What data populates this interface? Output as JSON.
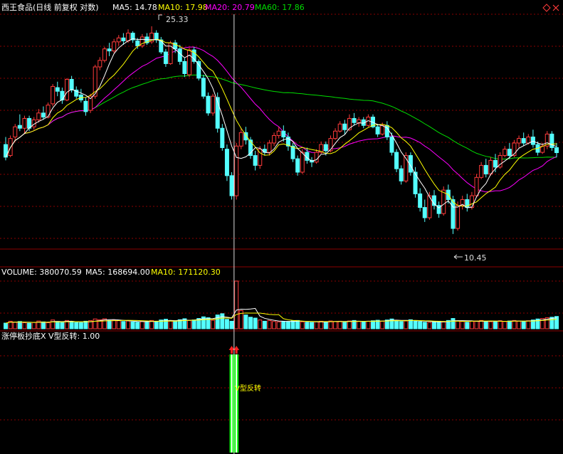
{
  "header": {
    "title": "西王食品(日线 前复权 对数)",
    "ma5_label": "MA5: 14.78",
    "ma10_label": "MA10: 17.98",
    "ma20_label": "MA20: 20.79",
    "ma60_label": "MA60: 17.86"
  },
  "volume_header": {
    "volume_label": "VOLUME: 380070.59",
    "ma5_label": "MA5: 168694.00",
    "ma10_label": "MA10: 171120.30"
  },
  "indicator_header": {
    "label": "涨停板抄底X V型反转: 1.00",
    "signal_text": "V型反转"
  },
  "annotations": {
    "high_label": "25.33",
    "low_label": "10.45"
  },
  "colors": {
    "up": "#ff3b3b",
    "down": "#54ffff",
    "ma5": "#ffffff",
    "ma10": "#ffff00",
    "ma20": "#ff00ff",
    "ma60": "#00dd00",
    "grid": "#8b0000",
    "signal_bar": "#00ff00",
    "signal_arrow": "#ff2020"
  },
  "chart_data": {
    "type": "candlestick",
    "price_scale": "log",
    "ylim": [
      9.8,
      26.5
    ],
    "highest": 25.33,
    "lowest": 10.45,
    "cursor_index": 48,
    "series": [
      {
        "name": "MA5",
        "last": 14.78
      },
      {
        "name": "MA10",
        "last": 17.98
      },
      {
        "name": "MA20",
        "last": 20.79
      },
      {
        "name": "MA60",
        "last": 17.86
      }
    ],
    "ohlc": [
      [
        15.3,
        15.8,
        14.3,
        14.5
      ],
      [
        14.6,
        15.9,
        14.5,
        15.7
      ],
      [
        15.8,
        16.7,
        15.5,
        16.5
      ],
      [
        16.6,
        17.4,
        16.2,
        16.4
      ],
      [
        16.4,
        17.3,
        16.0,
        17.1
      ],
      [
        17.1,
        17.3,
        16.2,
        16.4
      ],
      [
        16.5,
        17.2,
        16.3,
        17.0
      ],
      [
        17.0,
        17.8,
        16.8,
        17.5
      ],
      [
        17.5,
        18.0,
        17.0,
        17.2
      ],
      [
        17.2,
        18.3,
        17.1,
        18.1
      ],
      [
        18.2,
        19.8,
        18.0,
        19.6
      ],
      [
        19.5,
        20.0,
        18.8,
        19.2
      ],
      [
        19.2,
        19.5,
        18.2,
        18.5
      ],
      [
        18.5,
        20.3,
        18.4,
        20.2
      ],
      [
        20.2,
        20.5,
        19.1,
        19.3
      ],
      [
        19.3,
        19.6,
        18.6,
        18.8
      ],
      [
        18.9,
        19.4,
        18.3,
        18.5
      ],
      [
        18.4,
        18.7,
        17.3,
        17.6
      ],
      [
        17.7,
        19.0,
        17.5,
        18.8
      ],
      [
        18.8,
        21.5,
        18.6,
        21.3
      ],
      [
        21.3,
        22.2,
        21.0,
        21.9
      ],
      [
        21.9,
        23.2,
        21.7,
        23.0
      ],
      [
        23.0,
        23.6,
        22.3,
        22.8
      ],
      [
        22.8,
        24.0,
        22.6,
        23.7
      ],
      [
        23.7,
        24.4,
        23.3,
        24.1
      ],
      [
        24.1,
        24.6,
        23.4,
        23.8
      ],
      [
        23.8,
        25.0,
        23.6,
        24.6
      ],
      [
        24.6,
        24.8,
        23.6,
        23.9
      ],
      [
        23.8,
        24.1,
        23.0,
        23.3
      ],
      [
        23.3,
        24.5,
        23.1,
        24.2
      ],
      [
        24.2,
        24.6,
        23.4,
        23.6
      ],
      [
        23.7,
        25.33,
        23.5,
        24.6
      ],
      [
        24.6,
        24.9,
        23.6,
        23.9
      ],
      [
        23.9,
        24.2,
        22.5,
        22.7
      ],
      [
        22.7,
        23.0,
        21.3,
        21.6
      ],
      [
        21.6,
        23.8,
        21.5,
        23.6
      ],
      [
        23.6,
        23.9,
        22.6,
        23.0
      ],
      [
        23.0,
        23.4,
        21.5,
        21.8
      ],
      [
        21.8,
        22.1,
        20.4,
        20.7
      ],
      [
        20.6,
        23.1,
        20.4,
        22.9
      ],
      [
        22.9,
        23.2,
        21.6,
        21.8
      ],
      [
        21.8,
        22.0,
        20.1,
        20.3
      ],
      [
        20.3,
        20.6,
        18.6,
        18.8
      ],
      [
        18.8,
        19.1,
        17.3,
        17.5
      ],
      [
        17.5,
        19.0,
        17.3,
        18.8
      ],
      [
        18.7,
        19.1,
        16.1,
        16.4
      ],
      [
        16.4,
        16.7,
        14.9,
        15.1
      ],
      [
        15.0,
        15.3,
        13.1,
        13.4
      ],
      [
        13.4,
        13.6,
        12.1,
        12.3
      ],
      [
        12.3,
        15.4,
        12.1,
        15.2
      ],
      [
        15.2,
        16.4,
        15.0,
        16.1
      ],
      [
        16.1,
        16.5,
        15.3,
        15.6
      ],
      [
        15.6,
        15.8,
        14.4,
        14.6
      ],
      [
        14.6,
        14.9,
        13.7,
        14.0
      ],
      [
        14.0,
        15.2,
        13.8,
        15.0
      ],
      [
        15.0,
        15.3,
        14.6,
        14.8
      ],
      [
        14.8,
        15.6,
        14.6,
        15.4
      ],
      [
        15.4,
        16.1,
        15.2,
        15.9
      ],
      [
        15.9,
        16.5,
        15.7,
        16.2
      ],
      [
        16.2,
        16.6,
        15.5,
        15.8
      ],
      [
        15.8,
        16.1,
        14.9,
        15.2
      ],
      [
        15.2,
        15.4,
        14.2,
        14.4
      ],
      [
        14.4,
        14.6,
        13.4,
        13.6
      ],
      [
        13.6,
        15.0,
        13.5,
        14.8
      ],
      [
        14.8,
        15.1,
        14.1,
        14.3
      ],
      [
        14.3,
        14.5,
        13.9,
        14.2
      ],
      [
        14.2,
        15.0,
        14.1,
        14.8
      ],
      [
        14.8,
        15.5,
        14.7,
        15.3
      ],
      [
        15.3,
        15.5,
        14.6,
        14.9
      ],
      [
        14.9,
        15.9,
        14.8,
        15.7
      ],
      [
        15.7,
        16.4,
        15.6,
        16.2
      ],
      [
        16.2,
        16.9,
        16.1,
        16.7
      ],
      [
        16.7,
        17.0,
        16.0,
        16.3
      ],
      [
        16.3,
        17.4,
        16.2,
        17.1
      ],
      [
        17.1,
        17.5,
        16.6,
        16.8
      ],
      [
        16.8,
        17.2,
        16.5,
        17.0
      ],
      [
        17.0,
        17.2,
        16.4,
        16.6
      ],
      [
        16.6,
        17.4,
        16.5,
        17.2
      ],
      [
        17.2,
        17.4,
        16.4,
        16.5
      ],
      [
        16.5,
        16.7,
        15.8,
        16.0
      ],
      [
        16.0,
        16.8,
        15.9,
        16.6
      ],
      [
        16.6,
        16.9,
        15.6,
        15.8
      ],
      [
        15.8,
        16.1,
        14.6,
        14.8
      ],
      [
        14.8,
        15.0,
        13.6,
        13.8
      ],
      [
        13.8,
        14.0,
        12.9,
        13.1
      ],
      [
        13.1,
        14.8,
        13.0,
        14.6
      ],
      [
        14.6,
        14.8,
        13.4,
        13.6
      ],
      [
        13.6,
        13.9,
        12.2,
        12.4
      ],
      [
        12.4,
        12.7,
        11.5,
        11.7
      ],
      [
        11.7,
        12.1,
        11.0,
        11.2
      ],
      [
        11.2,
        12.5,
        11.1,
        12.3
      ],
      [
        12.3,
        12.6,
        11.6,
        11.8
      ],
      [
        11.8,
        12.0,
        11.2,
        11.4
      ],
      [
        11.4,
        12.8,
        11.3,
        12.6
      ],
      [
        12.6,
        12.9,
        11.9,
        12.1
      ],
      [
        12.1,
        12.3,
        10.45,
        10.7
      ],
      [
        10.7,
        12.0,
        10.6,
        11.8
      ],
      [
        11.8,
        12.3,
        11.6,
        12.1
      ],
      [
        12.1,
        12.4,
        11.5,
        11.7
      ],
      [
        11.7,
        12.5,
        11.6,
        12.3
      ],
      [
        12.3,
        13.5,
        12.2,
        13.3
      ],
      [
        13.3,
        14.2,
        13.2,
        14.0
      ],
      [
        14.0,
        14.4,
        13.3,
        13.5
      ],
      [
        13.5,
        14.5,
        13.4,
        14.3
      ],
      [
        14.3,
        14.7,
        13.6,
        13.9
      ],
      [
        13.9,
        14.8,
        13.8,
        14.6
      ],
      [
        14.6,
        15.2,
        14.5,
        15.0
      ],
      [
        15.0,
        15.4,
        14.4,
        14.6
      ],
      [
        14.6,
        15.6,
        14.5,
        15.4
      ],
      [
        15.4,
        15.9,
        15.1,
        15.7
      ],
      [
        15.7,
        16.1,
        15.2,
        15.4
      ],
      [
        15.4,
        16.0,
        15.3,
        15.8
      ],
      [
        15.8,
        16.3,
        15.1,
        15.3
      ],
      [
        15.3,
        15.5,
        14.6,
        14.8
      ],
      [
        14.8,
        15.4,
        14.7,
        15.2
      ],
      [
        15.2,
        16.2,
        15.0,
        16.0
      ],
      [
        16.0,
        16.2,
        14.9,
        15.1
      ],
      [
        15.1,
        15.4,
        14.5,
        14.78
      ]
    ],
    "volume": [
      45,
      60,
      52,
      58,
      48,
      44,
      50,
      62,
      55,
      48,
      70,
      58,
      52,
      66,
      55,
      50,
      48,
      60,
      65,
      78,
      72,
      80,
      66,
      70,
      64,
      58,
      62,
      55,
      52,
      60,
      56,
      66,
      58,
      70,
      76,
      62,
      58,
      72,
      80,
      66,
      70,
      82,
      95,
      88,
      68,
      110,
      120,
      75,
      60,
      380,
      145,
      110,
      92,
      85,
      70,
      60,
      65,
      58,
      55,
      60,
      58,
      62,
      66,
      55,
      52,
      50,
      56,
      60,
      54,
      62,
      58,
      60,
      56,
      62,
      66,
      58,
      54,
      60,
      64,
      68,
      60,
      70,
      78,
      66,
      58,
      62,
      72,
      64,
      56,
      52,
      50,
      56,
      60,
      54,
      66,
      82,
      62,
      58,
      52,
      60,
      62,
      66,
      58,
      56,
      60,
      64,
      58,
      62,
      66,
      60,
      58,
      64,
      70,
      78,
      82,
      88,
      92,
      98
    ],
    "signal": {
      "indices": [
        48,
        49
      ],
      "value": 1.0
    }
  }
}
